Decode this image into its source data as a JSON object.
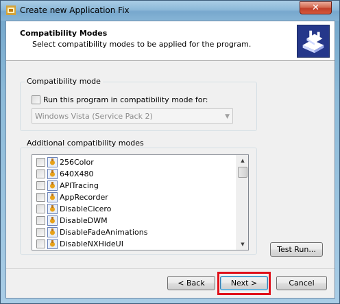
{
  "window": {
    "title": "Create new Application Fix",
    "close_label": "✕"
  },
  "header": {
    "title": "Compatibility Modes",
    "subtitle": "Select compatibility modes to be applied for the program."
  },
  "compat_mode": {
    "group_label": "Compatibility mode",
    "checkbox_label": "Run this program in compatibility mode for:",
    "checked": false,
    "selected_os": "Windows Vista (Service Pack 2)"
  },
  "additional": {
    "group_label": "Additional compatibility modes",
    "items": [
      {
        "label": "256Color",
        "checked": false
      },
      {
        "label": "640X480",
        "checked": false
      },
      {
        "label": "APITracing",
        "checked": false
      },
      {
        "label": "AppRecorder",
        "checked": false
      },
      {
        "label": "DisableCicero",
        "checked": false
      },
      {
        "label": "DisableDWM",
        "checked": false
      },
      {
        "label": "DisableFadeAnimations",
        "checked": false
      },
      {
        "label": "DisableNXHideUI",
        "checked": false
      }
    ]
  },
  "buttons": {
    "test_run": "Test Run...",
    "back": "< Back",
    "next": "Next >",
    "cancel": "Cancel"
  },
  "colors": {
    "highlight": "#e0101a",
    "icon_bg": "#2a3f8f"
  }
}
